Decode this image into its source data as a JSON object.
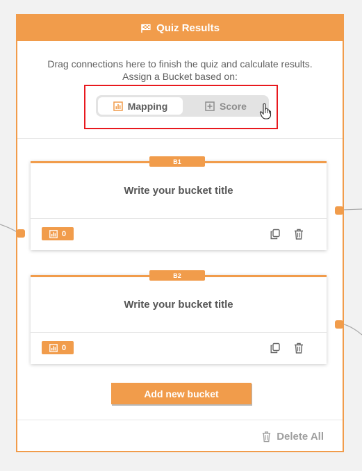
{
  "header": {
    "title": "Quiz Results",
    "icon": "flag-icon"
  },
  "intro": {
    "line1": "Drag connections here to finish the quiz and calculate results.",
    "line2": "Assign a Bucket based on:"
  },
  "toggle": {
    "options": [
      {
        "label": "Mapping",
        "icon": "chart-icon",
        "selected": true
      },
      {
        "label": "Score",
        "icon": "plus-square-icon",
        "selected": false
      }
    ]
  },
  "buckets": [
    {
      "tag": "B1",
      "title": "Write your bucket title",
      "count": "0"
    },
    {
      "tag": "B2",
      "title": "Write your bucket title",
      "count": "0"
    }
  ],
  "actions": {
    "add_bucket": "Add new bucket",
    "delete_all": "Delete All"
  },
  "colors": {
    "accent": "#f19c4b",
    "highlight_box": "#e8191e"
  }
}
